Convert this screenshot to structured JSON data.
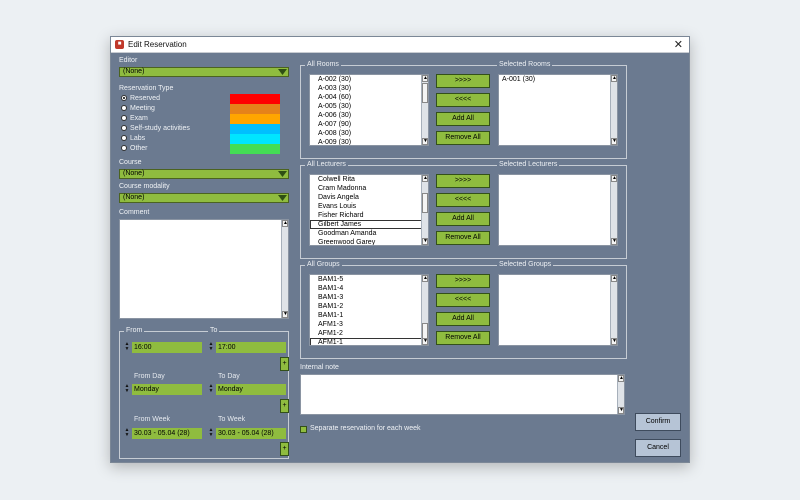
{
  "window": {
    "title": "Edit Reservation",
    "close_glyph": "✕"
  },
  "editor": {
    "label": "Editor",
    "value": "(None)"
  },
  "reservation_type": {
    "label": "Reservation Type",
    "options": [
      {
        "label": "Reserved",
        "checked": true,
        "color": "#ff0000"
      },
      {
        "label": "Meeting",
        "checked": false,
        "color": "#e5821a"
      },
      {
        "label": "Exam",
        "checked": false,
        "color": "#ffa500"
      },
      {
        "label": "Self-study activities",
        "checked": false,
        "color": "#00bfff"
      },
      {
        "label": "Labs",
        "checked": false,
        "color": "#00e5ff"
      },
      {
        "label": "Other",
        "checked": false,
        "color": "#44dd55"
      }
    ]
  },
  "course": {
    "label": "Course",
    "value": "(None)"
  },
  "course_modality": {
    "label": "Course modality",
    "value": "(None)"
  },
  "comment": {
    "label": "Comment",
    "value": ""
  },
  "time": {
    "from_label": "From",
    "to_label": "To",
    "from_value": "16:00",
    "to_value": "17:00",
    "from_day_label": "From Day",
    "to_day_label": "To Day",
    "from_day_value": "Monday",
    "to_day_value": "Monday",
    "from_week_label": "From Week",
    "to_week_label": "To Week",
    "from_week_value": "30.03 - 05.04 (28)",
    "to_week_value": "30.03 - 05.04 (28)",
    "plus": "+"
  },
  "rooms": {
    "all_label": "All Rooms",
    "selected_label": "Selected Rooms",
    "all_items": [
      "A-002 (30)",
      "A-003 (30)",
      "A-004 (60)",
      "A-005 (30)",
      "A-006 (30)",
      "A-007 (90)",
      "A-008 (30)",
      "A-009 (30)"
    ],
    "selected_items": [
      "A-001 (30)"
    ]
  },
  "lecturers": {
    "all_label": "All Lecturers",
    "selected_label": "Selected Lecturers",
    "all_items": [
      "Colwell Rita",
      "Cram Madonna",
      "Davis Angela",
      "Evans Louis",
      "Fisher Richard",
      "Gilbert James",
      "Goodman Amanda",
      "Greenwood Garey"
    ],
    "selected_items": []
  },
  "groups": {
    "all_label": "All Groups",
    "selected_label": "Selected Groups",
    "all_items": [
      "BAM1-5",
      "BAM1-4",
      "BAM1-3",
      "BAM1-2",
      "BAM1-1",
      "AFM1-3",
      "AFM1-2",
      "AFM1-1"
    ],
    "selected_items": []
  },
  "transfer_buttons": {
    "add_selected": ">>>>",
    "remove_selected": "<<<<",
    "add_all": "Add All",
    "remove_all": "Remove All"
  },
  "internal_note": {
    "label": "Internal note",
    "value": ""
  },
  "separate_reservation": {
    "label": "Separate reservation for each week",
    "checked": false
  },
  "actions": {
    "confirm": "Confirm",
    "cancel": "Cancel"
  },
  "colors": {
    "accent_green": "#8fbc3f",
    "panel": "#6b7a90"
  }
}
